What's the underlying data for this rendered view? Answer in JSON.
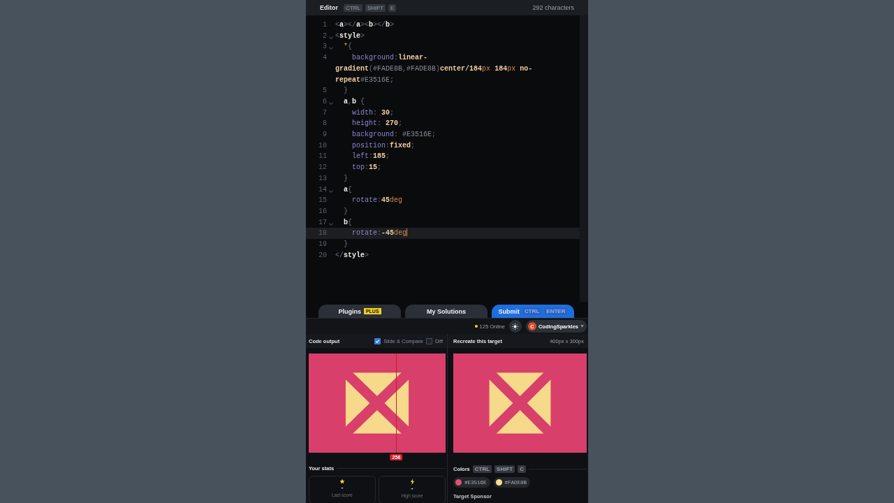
{
  "editor": {
    "title": "Editor",
    "shortcut": [
      "CTRL",
      "SHIFT",
      "E"
    ],
    "char_count": "292 characters",
    "lines": [
      {
        "number": "1",
        "foldable": false,
        "selected": false,
        "tokens": [
          {
            "text": "<",
            "kind": "punct"
          },
          {
            "text": "a",
            "kind": "tag"
          },
          {
            "text": "></",
            "kind": "punct"
          },
          {
            "text": "a",
            "kind": "tag"
          },
          {
            "text": "><",
            "kind": "punct"
          },
          {
            "text": "b",
            "kind": "tag"
          },
          {
            "text": "></",
            "kind": "punct"
          },
          {
            "text": "b",
            "kind": "tag"
          },
          {
            "text": ">",
            "kind": "punct"
          }
        ]
      },
      {
        "number": "2",
        "foldable": true,
        "selected": false,
        "tokens": [
          {
            "text": "<",
            "kind": "punct"
          },
          {
            "text": "style",
            "kind": "tag"
          },
          {
            "text": ">",
            "kind": "punct"
          }
        ]
      },
      {
        "number": "3",
        "foldable": true,
        "selected": false,
        "tokens": [
          {
            "text": "  *",
            "kind": "star"
          },
          {
            "text": "{",
            "kind": "punct"
          }
        ]
      },
      {
        "number": "4",
        "foldable": false,
        "selected": false,
        "tokens": [
          {
            "text": "    background",
            "kind": "prop"
          },
          {
            "text": ":",
            "kind": "punct"
          },
          {
            "text": "linear-gradient",
            "kind": "value"
          },
          {
            "text": "(",
            "kind": "punct"
          },
          {
            "text": "#FADE8B",
            "kind": "hex"
          },
          {
            "text": ",",
            "kind": "punct"
          },
          {
            "text": "#FADE8B",
            "kind": "hex"
          },
          {
            "text": ")",
            "kind": "punct"
          },
          {
            "text": "center/184",
            "kind": "value"
          },
          {
            "text": "px",
            "kind": "unit"
          },
          {
            "text": " 184",
            "kind": "value"
          },
          {
            "text": "px",
            "kind": "unit"
          },
          {
            "text": " no-repeat",
            "kind": "value"
          },
          {
            "text": "#E3516E",
            "kind": "hex"
          },
          {
            "text": ";",
            "kind": "punct"
          }
        ]
      },
      {
        "number": "5",
        "foldable": false,
        "selected": false,
        "tokens": [
          {
            "text": "  }",
            "kind": "punct"
          }
        ]
      },
      {
        "number": "6",
        "foldable": true,
        "selected": false,
        "tokens": [
          {
            "text": "  a",
            "kind": "tag"
          },
          {
            "text": ",",
            "kind": "punct"
          },
          {
            "text": "b",
            "kind": "tag"
          },
          {
            "text": " {",
            "kind": "punct"
          }
        ]
      },
      {
        "number": "7",
        "foldable": false,
        "selected": false,
        "tokens": [
          {
            "text": "    width",
            "kind": "prop"
          },
          {
            "text": ": ",
            "kind": "punct"
          },
          {
            "text": "30",
            "kind": "value"
          },
          {
            "text": ";",
            "kind": "punct"
          }
        ]
      },
      {
        "number": "8",
        "foldable": false,
        "selected": false,
        "tokens": [
          {
            "text": "    height",
            "kind": "prop"
          },
          {
            "text": ": ",
            "kind": "punct"
          },
          {
            "text": "270",
            "kind": "value"
          },
          {
            "text": ";",
            "kind": "punct"
          }
        ]
      },
      {
        "number": "9",
        "foldable": false,
        "selected": false,
        "tokens": [
          {
            "text": "    background",
            "kind": "prop"
          },
          {
            "text": ": ",
            "kind": "punct"
          },
          {
            "text": "#E3516E",
            "kind": "hex"
          },
          {
            "text": ";",
            "kind": "punct"
          }
        ]
      },
      {
        "number": "10",
        "foldable": false,
        "selected": false,
        "tokens": [
          {
            "text": "    position",
            "kind": "prop"
          },
          {
            "text": ":",
            "kind": "punct"
          },
          {
            "text": "fixed",
            "kind": "value"
          },
          {
            "text": ";",
            "kind": "punct"
          }
        ]
      },
      {
        "number": "11",
        "foldable": false,
        "selected": false,
        "tokens": [
          {
            "text": "    left",
            "kind": "prop"
          },
          {
            "text": ":",
            "kind": "punct"
          },
          {
            "text": "185",
            "kind": "value"
          },
          {
            "text": ";",
            "kind": "punct"
          }
        ]
      },
      {
        "number": "12",
        "foldable": false,
        "selected": false,
        "tokens": [
          {
            "text": "    top",
            "kind": "prop"
          },
          {
            "text": ":",
            "kind": "punct"
          },
          {
            "text": "15",
            "kind": "value"
          },
          {
            "text": ";",
            "kind": "punct"
          }
        ]
      },
      {
        "number": "13",
        "foldable": false,
        "selected": false,
        "tokens": [
          {
            "text": "  }",
            "kind": "punct"
          }
        ]
      },
      {
        "number": "14",
        "foldable": true,
        "selected": false,
        "tokens": [
          {
            "text": "  a",
            "kind": "tag"
          },
          {
            "text": "{",
            "kind": "punct"
          }
        ]
      },
      {
        "number": "15",
        "foldable": false,
        "selected": false,
        "tokens": [
          {
            "text": "    rotate",
            "kind": "prop"
          },
          {
            "text": ":",
            "kind": "punct"
          },
          {
            "text": "45",
            "kind": "value"
          },
          {
            "text": "deg",
            "kind": "unit"
          }
        ]
      },
      {
        "number": "16",
        "foldable": false,
        "selected": false,
        "tokens": [
          {
            "text": "  }",
            "kind": "punct"
          }
        ]
      },
      {
        "number": "17",
        "foldable": true,
        "selected": false,
        "tokens": [
          {
            "text": "  b",
            "kind": "tag"
          },
          {
            "text": "{",
            "kind": "punct"
          }
        ]
      },
      {
        "number": "18",
        "foldable": false,
        "selected": true,
        "tokens": [
          {
            "text": "    rotate",
            "kind": "prop"
          },
          {
            "text": ":",
            "kind": "punct"
          },
          {
            "text": "-45",
            "kind": "value"
          },
          {
            "text": "deg",
            "kind": "unit"
          }
        ]
      },
      {
        "number": "19",
        "foldable": false,
        "selected": false,
        "tokens": [
          {
            "text": "  }",
            "kind": "punct"
          }
        ]
      },
      {
        "number": "20",
        "foldable": false,
        "selected": false,
        "tokens": [
          {
            "text": "</",
            "kind": "punct"
          },
          {
            "text": "style",
            "kind": "tag"
          },
          {
            "text": ">",
            "kind": "punct"
          }
        ]
      }
    ]
  },
  "actions": [
    {
      "label": "Plugins",
      "badge": "PLUS",
      "kind": "plain"
    },
    {
      "label": "My Solutions",
      "kind": "plain"
    },
    {
      "label": "Submit",
      "shortcut": [
        "CTRL",
        "ENTER"
      ],
      "kind": "primary"
    }
  ],
  "status": {
    "online": "125 Online",
    "user_initial": "C",
    "user_name": "CodingSparkles"
  },
  "output": {
    "title": "Code output",
    "options": [
      {
        "label": "Slide & Compare",
        "checked": true
      },
      {
        "label": "Diff",
        "checked": false
      }
    ],
    "slider": {
      "reading": "256"
    }
  },
  "target": {
    "title": "Recreate this target",
    "size": "400px x 300px"
  },
  "stats": {
    "title": "Your stats",
    "cards": [
      {
        "kind": "star",
        "value": "-",
        "label": "Last score"
      },
      {
        "kind": "bolt",
        "value": "-",
        "label": "High score"
      }
    ]
  },
  "colors": {
    "title": "Colors",
    "shortcut": [
      "CTRL",
      "SHIFT",
      "C"
    ],
    "swatches": [
      {
        "label": "#E3516E",
        "color": "#e3516e"
      },
      {
        "label": "#FADE8B",
        "color": "#fade8b"
      }
    ]
  },
  "sponsor": {
    "title": "Target Sponsor"
  }
}
